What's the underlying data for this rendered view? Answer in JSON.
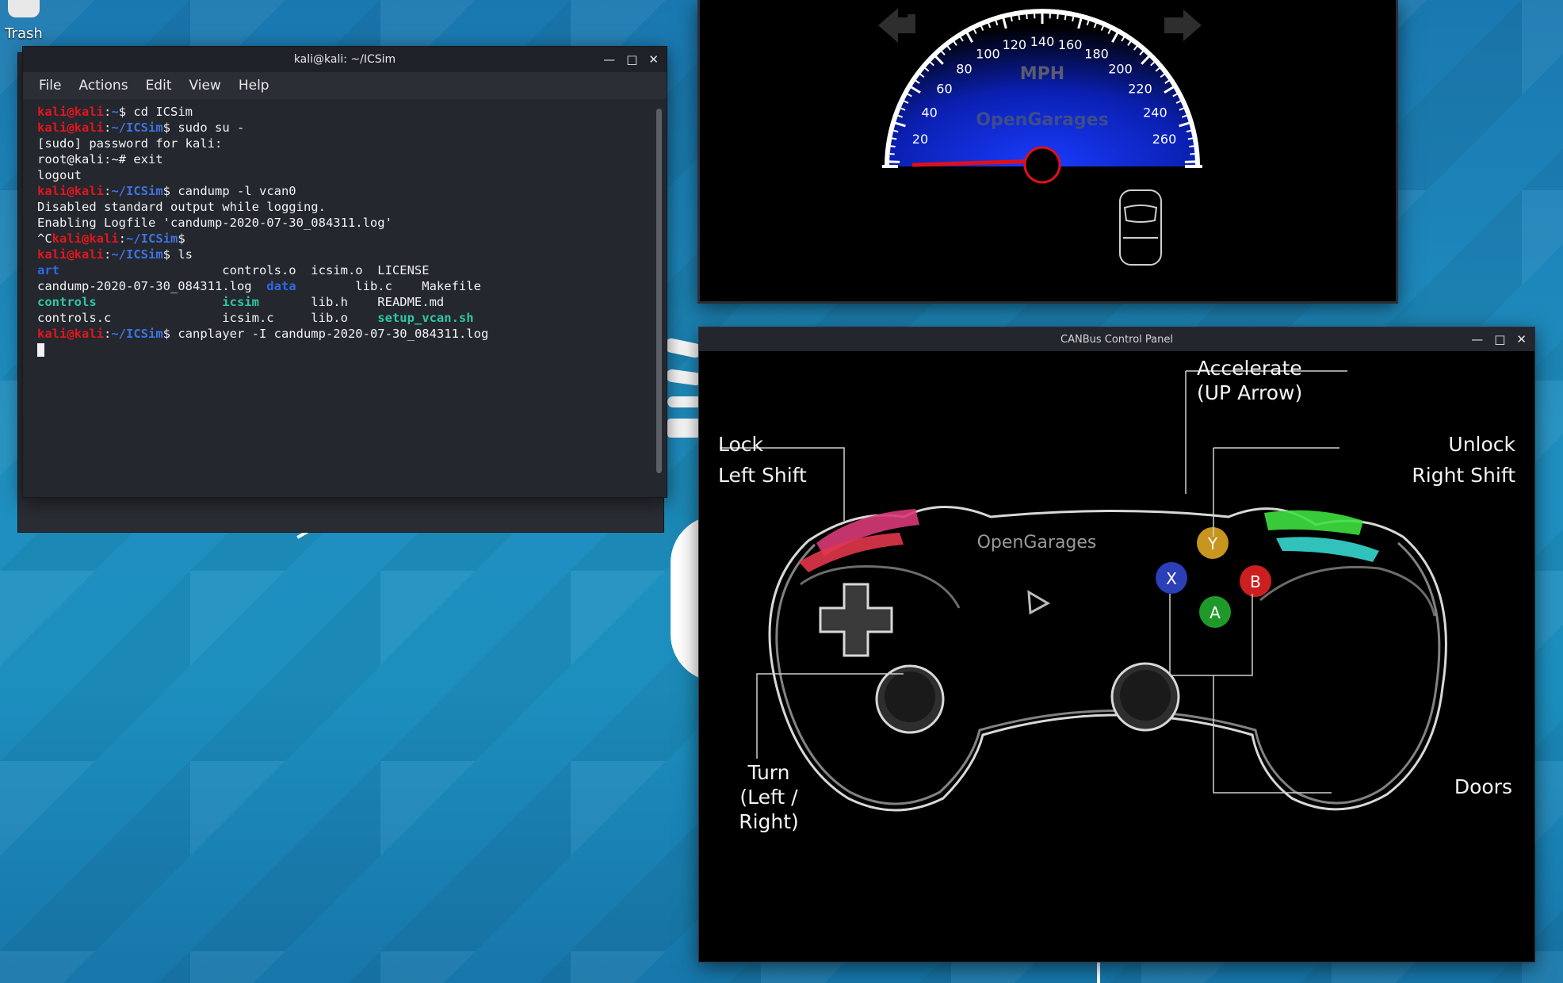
{
  "desktop": {
    "trash_label": "Trash"
  },
  "terminal": {
    "title": "kali@kali: ~/ICSim",
    "menu": [
      "File",
      "Actions",
      "Edit",
      "View",
      "Help"
    ],
    "lines": [
      [
        [
          "u",
          "kali@kali"
        ],
        [
          "t",
          ":"
        ],
        [
          "p",
          "~"
        ],
        [
          "t",
          "$ cd ICSim"
        ]
      ],
      [
        [
          "u",
          "kali@kali"
        ],
        [
          "t",
          ":"
        ],
        [
          "p",
          "~/ICSim"
        ],
        [
          "t",
          "$ sudo su -"
        ]
      ],
      [
        [
          "t",
          "[sudo] password for kali:"
        ]
      ],
      [
        [
          "t",
          "root@kali:~# exit"
        ]
      ],
      [
        [
          "t",
          "logout"
        ]
      ],
      [
        [
          "u",
          "kali@kali"
        ],
        [
          "t",
          ":"
        ],
        [
          "p",
          "~/ICSim"
        ],
        [
          "t",
          "$ candump -l vcan0"
        ]
      ],
      [
        [
          "t",
          "Disabled standard output while logging."
        ]
      ],
      [
        [
          "t",
          "Enabling Logfile 'candump-2020-07-30_084311.log'"
        ]
      ],
      [
        [
          "t",
          "^C"
        ],
        [
          "u",
          "kali@kali"
        ],
        [
          "t",
          ":"
        ],
        [
          "p",
          "~/ICSim"
        ],
        [
          "t",
          "$"
        ]
      ],
      [
        [
          "u",
          "kali@kali"
        ],
        [
          "t",
          ":"
        ],
        [
          "p",
          "~/ICSim"
        ],
        [
          "t",
          "$ ls"
        ]
      ],
      [
        [
          "d",
          "art"
        ],
        [
          "t",
          "                      controls.o  icsim.o  LICENSE"
        ]
      ],
      [
        [
          "t",
          "candump-2020-07-30_084311.log  "
        ],
        [
          "d",
          "data"
        ],
        [
          "t",
          "        lib.c    Makefile"
        ]
      ],
      [
        [
          "e",
          "controls"
        ],
        [
          "t",
          "                 "
        ],
        [
          "e",
          "icsim"
        ],
        [
          "t",
          "       lib.h    README.md"
        ]
      ],
      [
        [
          "t",
          "controls.c               icsim.c     lib.o    "
        ],
        [
          "e",
          "setup_vcan.sh"
        ]
      ],
      [
        [
          "u",
          "kali@kali"
        ],
        [
          "t",
          ":"
        ],
        [
          "p",
          "~/ICSim"
        ],
        [
          "t",
          "$ canplayer -I candump-2020-07-30_084311.log"
        ]
      ]
    ]
  },
  "speedometer": {
    "unit": "MPH",
    "brand": "OpenGarages",
    "ticks": [
      "20",
      "40",
      "60",
      "80",
      "100",
      "120",
      "140",
      "160",
      "180",
      "200",
      "220",
      "240",
      "260"
    ],
    "current_speed": 0,
    "colors": {
      "face_center": "#1a3cff",
      "needle": "#e0101a",
      "rim": "#ffffff"
    }
  },
  "control_panel": {
    "title": "CANBus Control Panel",
    "brand": "OpenGarages",
    "labels": {
      "accelerate": "Accelerate",
      "accelerate_key": "(UP Arrow)",
      "lock": "Lock",
      "lock_key": "Left Shift",
      "unlock": "Unlock",
      "unlock_key": "Right Shift",
      "turn": "Turn",
      "turn_keys": "(Left / Right)",
      "doors": "Doors"
    },
    "buttons": {
      "y": "Y",
      "x": "X",
      "b": "B",
      "a": "A"
    },
    "colors": {
      "y": "#c8951e",
      "x": "#2a3fb8",
      "b": "#cc1f1f",
      "a": "#1f9a2a",
      "lock": "#e0307a",
      "lock2": "#e03a52",
      "unlock": "#3fd63f",
      "unlock2": "#36d8d0"
    }
  }
}
